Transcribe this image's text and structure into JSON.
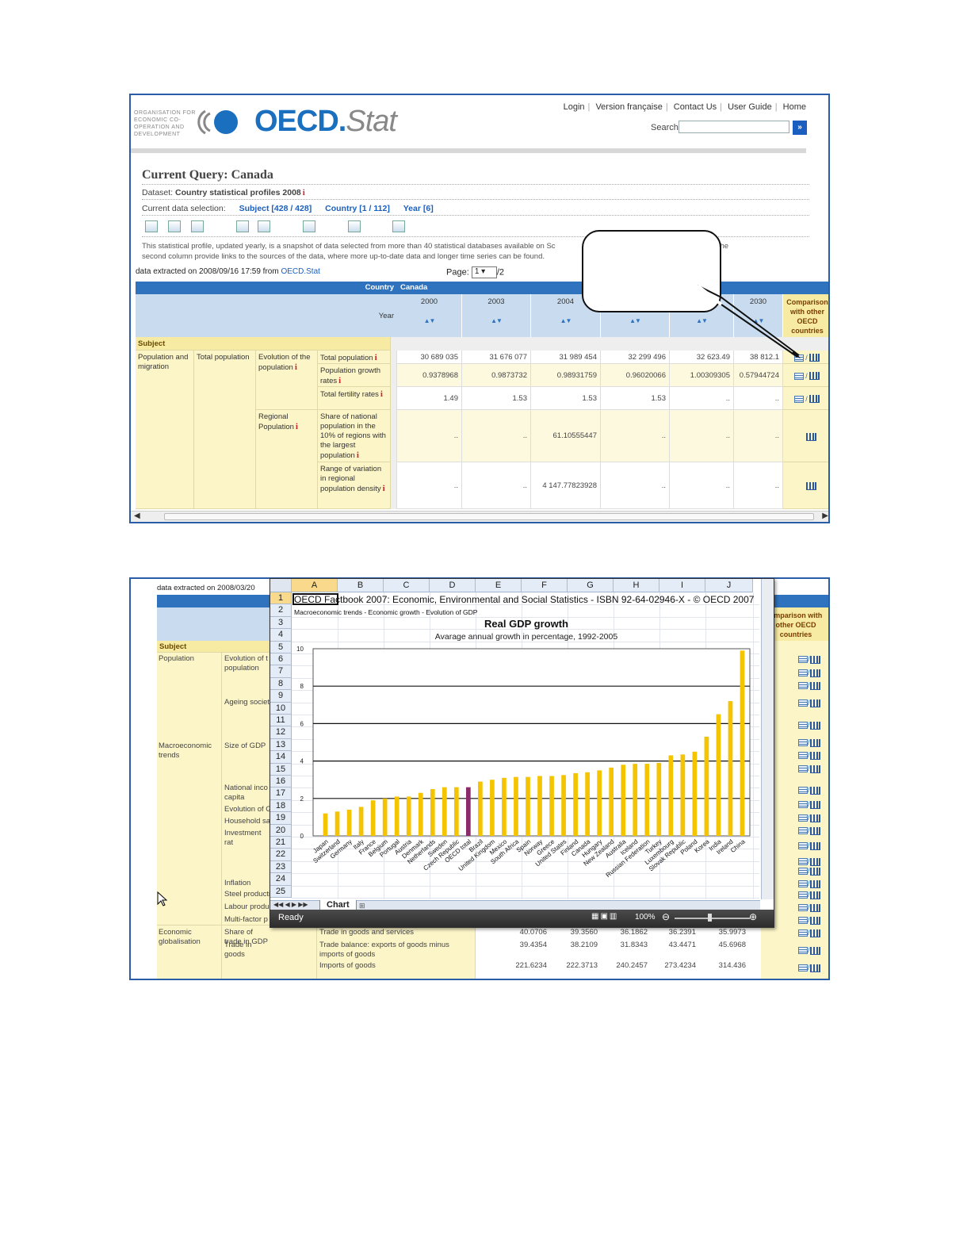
{
  "top": {
    "logo_text": "ORGANISATION FOR ECONOMIC CO-OPERATION AND DEVELOPMENT",
    "brand_main": "OECD.",
    "brand_stat": "Stat",
    "links": [
      "Login",
      "Version française",
      "Contact Us",
      "User Guide",
      "Home"
    ],
    "search_label": "Search",
    "search_button": "»",
    "query_title": "Current Query: Canada",
    "dataset_label": "Dataset:",
    "dataset_value": "Country statistical profiles 2008",
    "selection_label": "Current data selection:",
    "selection_links": [
      "Subject [428 / 428]",
      "Country [1 / 112]",
      "Year [6]"
    ],
    "description_line1": "This statistical profile, updated yearly, is a snapshot of data selected from more than 40 statistical databases available on Sc",
    "description_tail": "'s in the",
    "description_line2": "second column provide links to the sources of the data, where more up-to-date data and longer time series can be found.",
    "extracted_prefix": "data extracted on 2008/09/16 17:59 from",
    "extracted_link": "OECD.Stat",
    "page_label": "Page:",
    "page_value": "1",
    "page_total": "/2",
    "table": {
      "country_label": "Country",
      "country_value": "Canada",
      "year_label": "Year",
      "years": [
        "2000",
        "2003",
        "2004",
        "",
        "",
        "2030"
      ],
      "comparison_header": "Comparison with other OECD countries",
      "subject_label": "Subject",
      "rows": [
        {
          "c1": "Population and migration",
          "c2": "Total population",
          "c3": "Evolution of the population",
          "c4": "Total population",
          "values": [
            "30 689 035",
            "31 676 077",
            "31 989 454",
            "32 299 496",
            "32 623.49",
            "38 812.1"
          ]
        },
        {
          "c4": "Population growth rates",
          "values": [
            "0.9378968",
            "0.9873732",
            "0.98931759",
            "0.96020066",
            "1.00309305",
            "0.57944724"
          ]
        },
        {
          "c4": "Total fertility rates",
          "values": [
            "1.49",
            "1.53",
            "1.53",
            "1.53",
            "..",
            ".."
          ]
        },
        {
          "c3": "Regional Population",
          "c4": "Share of national population in the 10% of regions with the largest population",
          "values": [
            "..",
            "..",
            "61.10555447",
            "..",
            "..",
            ".."
          ]
        },
        {
          "c4": "Range of variation in regional population density",
          "values": [
            "..",
            "..",
            "4 147.77823928",
            "..",
            "..",
            ".."
          ]
        }
      ]
    }
  },
  "bottom": {
    "extracted": "data extracted on 2008/03/20",
    "subject_label": "Subject",
    "comparison_header": "omparison with other OECD countries",
    "left_rows": [
      {
        "c1": "Population",
        "c2": "Evolution of t population"
      },
      {
        "c2": "Ageing societ"
      },
      {
        "c1": "Macroeconomic trends",
        "c2": "Size of GDP"
      },
      {
        "c2": "National inco capita"
      },
      {
        "c2": "Evolution of G"
      },
      {
        "c2": "Household sa"
      },
      {
        "c2": "Investment rat"
      },
      {
        "c2": "Inflation"
      },
      {
        "c2": "Steel producti"
      },
      {
        "c2": "Labour produ"
      },
      {
        "c2": "Multi-factor p"
      },
      {
        "c1": "Economic globalisation",
        "c2": "Share of trade in GDP",
        "c3": "Trade in goods and services",
        "values": [
          "40.0706",
          "39.3560",
          "36.1862",
          "36.2391",
          "35.9973"
        ]
      },
      {
        "c2": "Trade in goods",
        "c3": "Trade balance: exports of goods minus imports of goods",
        "values": [
          "39.4354",
          "38.2109",
          "31.8343",
          "43.4471",
          "45.6968"
        ]
      },
      {
        "c3": "Imports of goods",
        "values": [
          "221.6234",
          "222.3713",
          "240.2457",
          "273.4234",
          "314.436"
        ]
      }
    ],
    "excel": {
      "columns": [
        "A",
        "B",
        "C",
        "D",
        "E",
        "F",
        "G",
        "H",
        "I",
        "J"
      ],
      "row1": "OECD Factbook 2007: Economic, Environmental and Social Statistics - ISBN 92-64-02946-X - © OECD 2007",
      "row2": "Macroeconomic trends - Economic growth - Evolution of GDP",
      "sheet_tab": "Chart",
      "status": "Ready",
      "zoom": "100%"
    }
  },
  "chart_data": {
    "type": "bar",
    "title": "Real GDP growth",
    "subtitle": "Avarage annual growth in percentage, 1992-2005",
    "ylim": [
      0,
      10
    ],
    "yticks": [
      0,
      2,
      4,
      6,
      8,
      10
    ],
    "categories": [
      "Japan",
      "Switzerland",
      "Germany",
      "Italy",
      "France",
      "Belgium",
      "Portugal",
      "Austria",
      "Denmark",
      "Netherlands",
      "Sweden",
      "Czech Republic",
      "OECD total",
      "Brazil",
      "United Kingdom",
      "Mexico",
      "South Africa",
      "Spain",
      "Norway",
      "Greece",
      "United States",
      "Finland",
      "Canada",
      "Hungary",
      "New Zealand",
      "Australia",
      "Iceland",
      "Russian Federation",
      "Turkey",
      "Luxembourg",
      "Slovak Republic",
      "Poland",
      "Korea",
      "India",
      "Ireland",
      "China"
    ],
    "values": [
      1.2,
      1.3,
      1.4,
      1.55,
      1.9,
      2.0,
      2.1,
      2.1,
      2.3,
      2.5,
      2.6,
      2.6,
      2.6,
      2.9,
      3.0,
      3.1,
      3.15,
      3.15,
      3.2,
      3.2,
      3.25,
      3.35,
      3.4,
      3.5,
      3.65,
      3.8,
      3.85,
      3.85,
      3.9,
      4.3,
      4.35,
      4.5,
      5.3,
      6.5,
      7.2,
      9.9
    ],
    "colors": {
      "bar": "#f5c400",
      "highlight": "#8b2b6a"
    },
    "highlight_category": "OECD total"
  }
}
